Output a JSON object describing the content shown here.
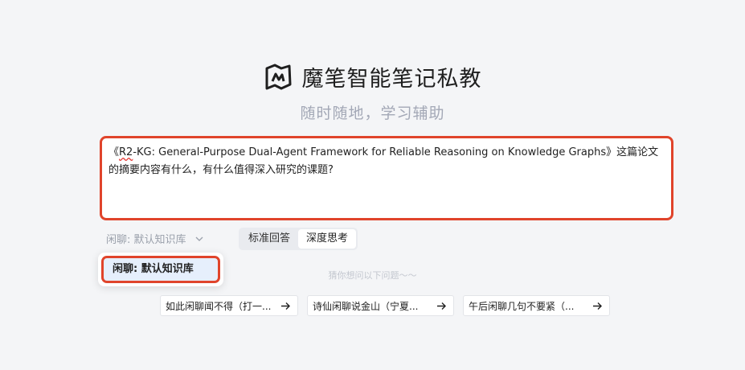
{
  "brand": {
    "title": "魔笔智能笔记私教",
    "logo_icon": "mobi-logo-icon"
  },
  "subtitle": "随时随地，学习辅助",
  "editor": {
    "query_prefix": "《",
    "query_misspelled": "R2",
    "query_rest": "-KG: General-Purpose Dual-Agent Framework for Reliable Reasoning on Knowledge Graphs》这篇论文的摘要内容有什么，有什么值得深入研究的课题?"
  },
  "controls": {
    "knowledge_base": "闲聊: 默认知识库",
    "modes": [
      "标准回答",
      "深度思考"
    ],
    "active_mode": "深度思考"
  },
  "dropdown": {
    "items": [
      "闲聊: 默认知识库"
    ]
  },
  "suggestions": {
    "title": "猜你想问以下问题～～",
    "items": [
      "如此闲聊闻不得（打一...",
      "诗仙闲聊说金山（宁夏...",
      "午后闲聊几句不要紧（..."
    ]
  },
  "colors": {
    "highlight_border": "#e0442b",
    "background": "#f4f5f7",
    "dropdown_selected": "#e6effc"
  }
}
